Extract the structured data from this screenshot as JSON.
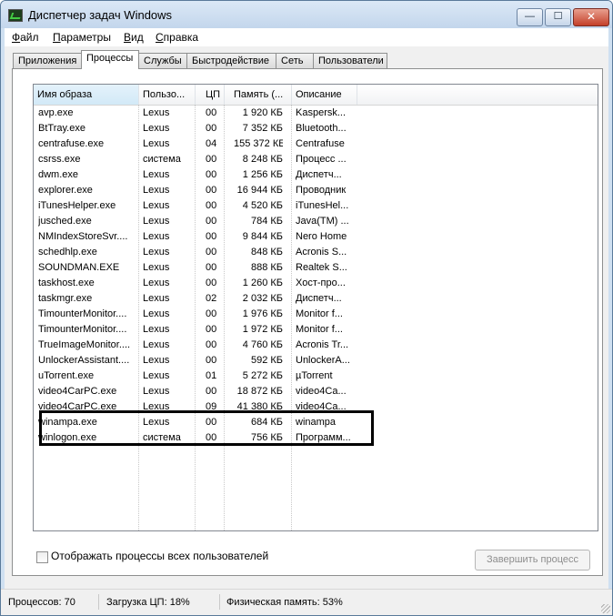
{
  "window": {
    "title": "Диспетчер задач Windows",
    "minimize_glyph": "—",
    "maximize_glyph": "☐",
    "close_glyph": "✕"
  },
  "menu": [
    {
      "u": "Ф",
      "rest": "айл"
    },
    {
      "u": "П",
      "rest": "араметры"
    },
    {
      "u": "В",
      "rest": "ид"
    },
    {
      "u": "С",
      "rest": "правка"
    }
  ],
  "tabs": [
    "Приложения",
    "Процессы",
    "Службы",
    "Быстродействие",
    "Сеть",
    "Пользователи"
  ],
  "active_tab": "Процессы",
  "columns": {
    "name": "Имя образа",
    "user": "Пользо...",
    "cpu": "ЦП",
    "mem": "Память (...",
    "desc": "Описание",
    "sort_indicator": "^"
  },
  "processes": [
    {
      "name": "avp.exe",
      "user": "Lexus",
      "cpu": "00",
      "mem": "1 920 КБ",
      "desc": "Kaspersk..."
    },
    {
      "name": "BtTray.exe",
      "user": "Lexus",
      "cpu": "00",
      "mem": "7 352 КБ",
      "desc": "Bluetooth..."
    },
    {
      "name": "centrafuse.exe",
      "user": "Lexus",
      "cpu": "04",
      "mem": "155 372 КБ",
      "desc": "Centrafuse"
    },
    {
      "name": "csrss.exe",
      "user": "система",
      "cpu": "00",
      "mem": "8 248 КБ",
      "desc": "Процесс ..."
    },
    {
      "name": "dwm.exe",
      "user": "Lexus",
      "cpu": "00",
      "mem": "1 256 КБ",
      "desc": "Диспетч..."
    },
    {
      "name": "explorer.exe",
      "user": "Lexus",
      "cpu": "00",
      "mem": "16 944 КБ",
      "desc": "Проводник"
    },
    {
      "name": "iTunesHelper.exe",
      "user": "Lexus",
      "cpu": "00",
      "mem": "4 520 КБ",
      "desc": "iTunesHel..."
    },
    {
      "name": "jusched.exe",
      "user": "Lexus",
      "cpu": "00",
      "mem": "784 КБ",
      "desc": "Java(TM) ..."
    },
    {
      "name": "NMIndexStoreSvr....",
      "user": "Lexus",
      "cpu": "00",
      "mem": "9 844 КБ",
      "desc": "Nero Home"
    },
    {
      "name": "schedhlp.exe",
      "user": "Lexus",
      "cpu": "00",
      "mem": "848 КБ",
      "desc": "Acronis S..."
    },
    {
      "name": "SOUNDMAN.EXE",
      "user": "Lexus",
      "cpu": "00",
      "mem": "888 КБ",
      "desc": "Realtek S..."
    },
    {
      "name": "taskhost.exe",
      "user": "Lexus",
      "cpu": "00",
      "mem": "1 260 КБ",
      "desc": "Хост-про..."
    },
    {
      "name": "taskmgr.exe",
      "user": "Lexus",
      "cpu": "02",
      "mem": "2 032 КБ",
      "desc": "Диспетч..."
    },
    {
      "name": "TimounterMonitor....",
      "user": "Lexus",
      "cpu": "00",
      "mem": "1 976 КБ",
      "desc": "Monitor f..."
    },
    {
      "name": "TimounterMonitor....",
      "user": "Lexus",
      "cpu": "00",
      "mem": "1 972 КБ",
      "desc": "Monitor f..."
    },
    {
      "name": "TrueImageMonitor....",
      "user": "Lexus",
      "cpu": "00",
      "mem": "4 760 КБ",
      "desc": "Acronis Tr..."
    },
    {
      "name": "UnlockerAssistant....",
      "user": "Lexus",
      "cpu": "00",
      "mem": "592 КБ",
      "desc": "UnlockerA..."
    },
    {
      "name": "uTorrent.exe",
      "user": "Lexus",
      "cpu": "01",
      "mem": "5 272 КБ",
      "desc": "µTorrent"
    },
    {
      "name": "video4CarPC.exe",
      "user": "Lexus",
      "cpu": "00",
      "mem": "18 872 КБ",
      "desc": "video4Ca..."
    },
    {
      "name": "video4CarPC.exe",
      "user": "Lexus",
      "cpu": "09",
      "mem": "41 380 КБ",
      "desc": "video4Ca..."
    },
    {
      "name": "winampa.exe",
      "user": "Lexus",
      "cpu": "00",
      "mem": "684 КБ",
      "desc": "winampa"
    },
    {
      "name": "winlogon.exe",
      "user": "система",
      "cpu": "00",
      "mem": "756 КБ",
      "desc": "Программ..."
    }
  ],
  "show_all_users_label": "Отображать процессы всех пользователей",
  "show_all_users_checked": false,
  "end_process_label": "Завершить процесс",
  "status": {
    "processes": "Процессов: 70",
    "cpu": "Загрузка ЦП: 18%",
    "memory": "Физическая память: 53%"
  }
}
